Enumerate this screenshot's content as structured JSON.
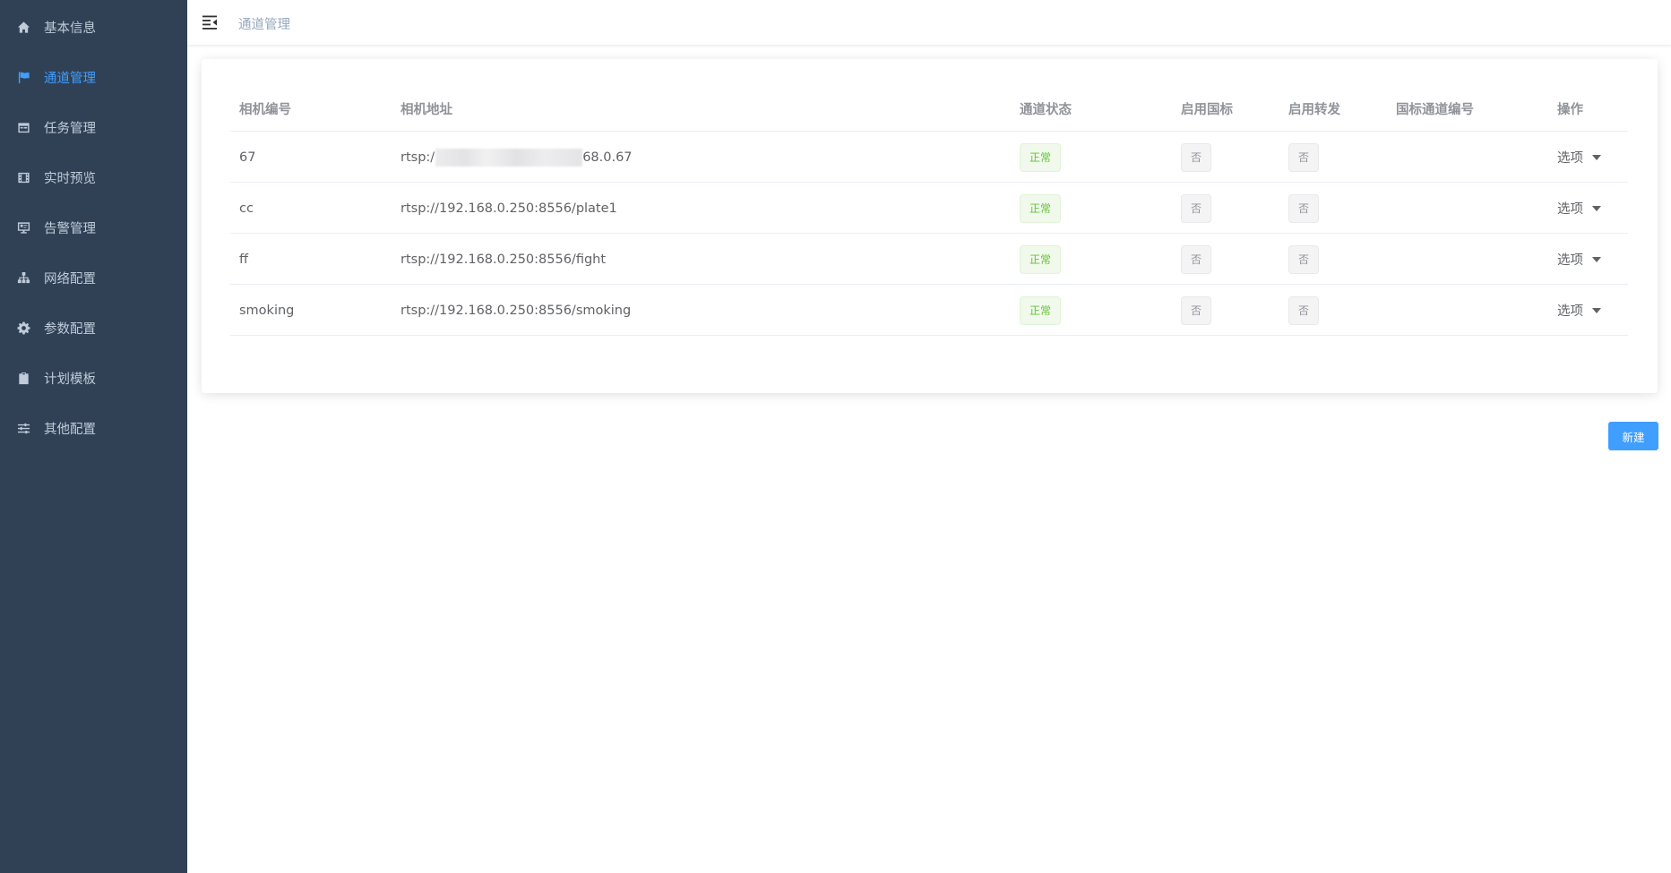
{
  "sidebar": {
    "items": [
      {
        "label": "基本信息",
        "icon": "home-icon"
      },
      {
        "label": "通道管理",
        "icon": "flag-icon",
        "active": true
      },
      {
        "label": "任务管理",
        "icon": "calendar-icon"
      },
      {
        "label": "实时预览",
        "icon": "film-icon"
      },
      {
        "label": "告警管理",
        "icon": "monitor-alert-icon"
      },
      {
        "label": "网络配置",
        "icon": "sitemap-icon"
      },
      {
        "label": "参数配置",
        "icon": "gear-icon"
      },
      {
        "label": "计划模板",
        "icon": "clipboard-check-icon"
      },
      {
        "label": "其他配置",
        "icon": "sliders-icon"
      }
    ],
    "active_color": "#409eff"
  },
  "navbar": {
    "breadcrumb": "通道管理"
  },
  "table": {
    "headers": {
      "camera_id": "相机编号",
      "camera_url": "相机地址",
      "status": "通道状态",
      "gb_enabled": "启用国标",
      "forward_enabled": "启用转发",
      "gb_channel_id": "国标通道编号",
      "ops": "操作"
    },
    "rows": [
      {
        "camera_id": "67",
        "url_prefix": "rtsp:/",
        "url_suffix": "68.0.67",
        "status": "正常",
        "gb_enabled": "否",
        "forward_enabled": "否",
        "gb_channel_id": "",
        "ops": "选项"
      },
      {
        "camera_id": "cc",
        "url_prefix": "rtsp://192.168.0.250:8556/plate1",
        "url_suffix": "",
        "status": "正常",
        "gb_enabled": "否",
        "forward_enabled": "否",
        "gb_channel_id": "",
        "ops": "选项"
      },
      {
        "camera_id": "ff",
        "url_prefix": "rtsp://192.168.0.250:8556/fight",
        "url_suffix": "",
        "status": "正常",
        "gb_enabled": "否",
        "forward_enabled": "否",
        "gb_channel_id": "",
        "ops": "选项"
      },
      {
        "camera_id": "smoking",
        "url_prefix": "rtsp://192.168.0.250:8556/smoking",
        "url_suffix": "",
        "status": "正常",
        "gb_enabled": "否",
        "forward_enabled": "否",
        "gb_channel_id": "",
        "ops": "选项"
      }
    ]
  },
  "actions": {
    "new_label": "新建"
  },
  "colors": {
    "sidebar_bg": "#304156",
    "primary": "#409eff",
    "success": "#67c23a"
  }
}
